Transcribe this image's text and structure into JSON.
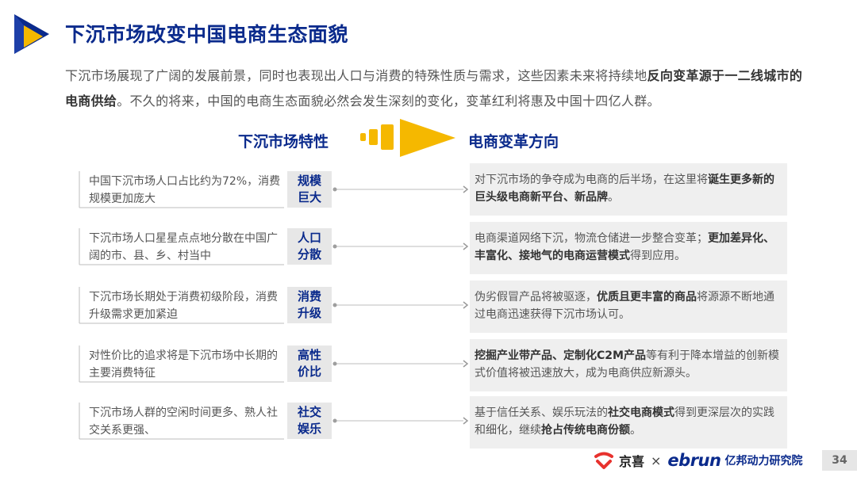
{
  "header": {
    "title": "下沉市场改变中国电商生态面貌"
  },
  "intro": {
    "part1": "下沉市场展现了广阔的发展前景，同时也表现出人口与消费的特殊性质与需求，这些因素未来将持续地",
    "bold1": "反向变革源于一二线城市的电商供给",
    "part2": "。不久的将来，中国的电商生态面貌必然会发生深刻的变化，变革红利将惠及中国十四亿人群。"
  },
  "headings": {
    "left": "下沉市场特性",
    "right": "电商变革方向"
  },
  "rows": [
    {
      "left": "中国下沉市场人口占比约为72%，消费规模更加庞大",
      "tag": "规模巨大",
      "r1": "对下沉市场的争夺成为电商的后半场，在这里将",
      "rb1": "诞生更多新的巨头级电商新平台、新品牌",
      "r2": "。",
      "rb2": "",
      "r3": ""
    },
    {
      "left": "下沉市场人口星星点点地分散在中国广阔的市、县、乡、村当中",
      "tag": "人口分散",
      "r1": "电商渠道网络下沉，物流仓储进一步整合变革；",
      "rb1": "更加差异化、丰富化、接地气的电商运营模式",
      "r2": "得到应用。",
      "rb2": "",
      "r3": ""
    },
    {
      "left": "下沉市场长期处于消费初级阶段，消费升级需求更加紧迫",
      "tag": "消费升级",
      "r1": "伪劣假冒产品将被驱逐，",
      "rb1": "优质且更丰富的商品",
      "r2": "将源源不断地通过电商迅速获得下沉市场认可。",
      "rb2": "",
      "r3": ""
    },
    {
      "left": "对性价比的追求将是下沉市场中长期的主要消费特征",
      "tag": "高性价比",
      "r1": "",
      "rb1": "挖掘产业带产品、定制化C2M产品",
      "r2": "等有利于降本增益的创新模式价值将被迅速放大，成为电商供应新源头。",
      "rb2": "",
      "r3": ""
    },
    {
      "left": "下沉市场人群的空闲时间更多、熟人社交关系更强、",
      "tag": "社交娱乐",
      "r1": "基于信任关系、娱乐玩法的",
      "rb1": "社交电商模式",
      "r2": "得到更深层次的实践和细化，继续",
      "rb2": "抢占传统电商份额",
      "r3": "。"
    }
  ],
  "footer": {
    "brand1": "京喜",
    "times": "×",
    "brand2": "ebrun",
    "brand3": "亿邦动力研究院",
    "page": "34"
  },
  "colors": {
    "navy": "#0a2a8c",
    "accent": "#f5b800",
    "tag_bg": "#e7e7e7",
    "box_bg": "#efefef",
    "jx_red": "#e8322e"
  }
}
